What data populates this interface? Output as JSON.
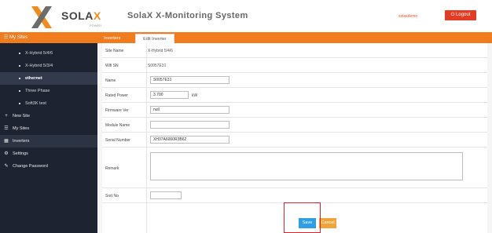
{
  "header": {
    "logo_main": "SOLA",
    "logo_x": "X",
    "logo_sub": "POWER",
    "app_title": "SolaX X-Monitoring System",
    "user_name": "solaxdemo",
    "logout_label": "Logout",
    "logout_icon": "power-icon",
    "accent_color": "#f07c1e"
  },
  "sidebar": {
    "head": "My Sites",
    "sub_items": [
      {
        "label": "X-Hybrid 5/4/6"
      },
      {
        "label": "X-Hybrid 5/3/4"
      },
      {
        "label": "ethernet"
      },
      {
        "label": "Three Phase"
      },
      {
        "label": "Soft3K test"
      }
    ],
    "items": [
      {
        "label": "New Site",
        "icon": "plus-icon"
      },
      {
        "label": "My Sites",
        "icon": "list-icon"
      },
      {
        "label": "Inverters",
        "icon": "inverter-icon"
      },
      {
        "label": "Settings",
        "icon": "gear-icon"
      },
      {
        "label": "Change Password",
        "icon": "key-icon"
      }
    ]
  },
  "tabs": [
    {
      "label": "Inverters"
    },
    {
      "label": "Edit Inverter"
    }
  ],
  "form": {
    "site_name_label": "Site Name",
    "site_name_value": "X-Hybrid 5/4/6",
    "wifi_sn_label": "Wifi SN",
    "wifi_sn_value": "S0057E31",
    "name_label": "Name",
    "name_value": "S0057E31",
    "rated_power_label": "Rated Power",
    "rated_power_value": "3.700",
    "rated_power_unit": "kW",
    "firmware_label": "Firmware Ver",
    "firmware_value": "null",
    "module_name_label": "Module Name",
    "module_name_value": "",
    "serial_label": "Serial Number",
    "serial_value": "XH37A6000R3B62",
    "remark_label": "Remark",
    "remark_value": "",
    "sort_label": "Sort No",
    "sort_value": "",
    "save_label": "Save",
    "cancel_label": "Cancel"
  }
}
